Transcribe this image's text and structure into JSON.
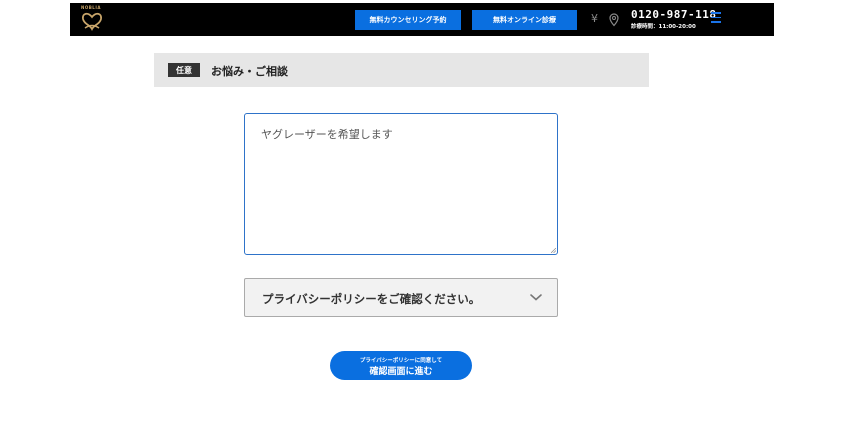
{
  "header": {
    "logo_text": "NOBLIA",
    "counsel_button": "無料カウンセリング予約",
    "online_button": "無料オンライン診療",
    "yen_symbol": "¥",
    "phone": "0120-987-118",
    "hours": "診療時間：11:00-20:00",
    "menu_icon": "hamburger-icon",
    "pin_icon": "location-pin-icon",
    "colors": {
      "bar": "#000000",
      "button": "#0a6fe0",
      "logo": "#c9a66b"
    }
  },
  "section": {
    "badge": "任意",
    "title": "お悩み・ご相談"
  },
  "form": {
    "textarea_value": "ヤグレーザーを希望します",
    "policy_label": "プライバシーポリシーをご確認ください。",
    "policy_icon": "chevron-down-icon"
  },
  "submit": {
    "small": "プライバシーポリシーに同意して",
    "main": "確認画面に進む"
  }
}
